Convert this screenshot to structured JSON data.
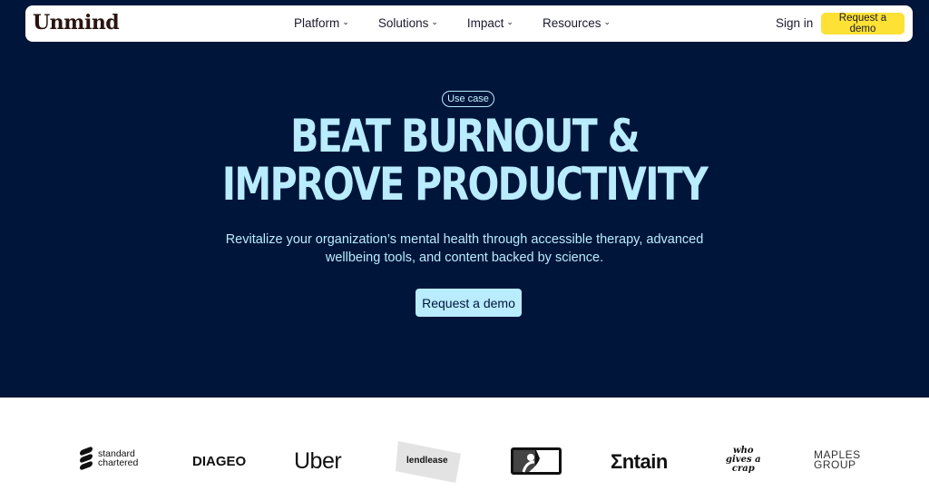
{
  "nav": {
    "logo": "Unmind",
    "menu": [
      {
        "label": "Platform"
      },
      {
        "label": "Solutions"
      },
      {
        "label": "Impact"
      },
      {
        "label": "Resources"
      }
    ],
    "sign_in": "Sign in",
    "request_demo": "Request a demo"
  },
  "hero": {
    "pill": "Use case",
    "headline_line1": "BEAT BURNOUT &",
    "headline_line2": "IMPROVE PRODUCTIVITY",
    "sub_line1": "Revitalize your organization’s mental health through accessible therapy, advanced",
    "sub_line2": "wellbeing tools, and content backed by science.",
    "cta": "Request a demo"
  },
  "logos": {
    "standard_chartered": [
      "standard",
      "chartered"
    ],
    "diageo": "DIAGEO",
    "uber": "Uber",
    "lendlease": "lendlease",
    "entain": "Σntain",
    "who_gives_a_crap": [
      "who",
      "gives a",
      "crap"
    ],
    "maples": [
      "MAPLES",
      "GROUP"
    ]
  },
  "colors": {
    "hero_bg": "#00153a",
    "accent_light_blue": "#b9ecff",
    "nav_cta_yellow": "#fde134"
  }
}
